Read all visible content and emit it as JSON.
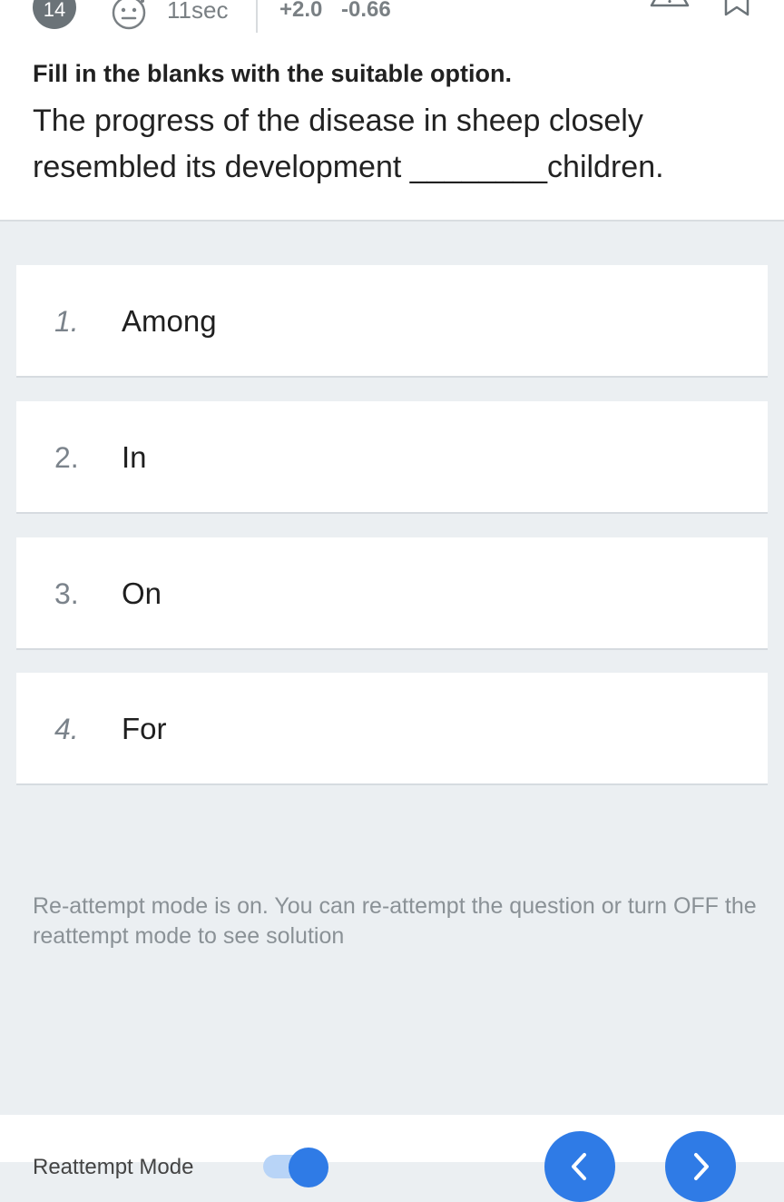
{
  "header": {
    "question_number": "14",
    "timer": "11sec",
    "marks_positive": "+2.0",
    "marks_negative": "-0.66",
    "icons": [
      "neutral-face-icon",
      "warning-icon",
      "bookmark-icon"
    ]
  },
  "question": {
    "instruction": "Fill in the blanks with the suitable option.",
    "text": "The progress of the disease in sheep closely resembled its development ________children."
  },
  "options": [
    {
      "number": "1.",
      "label": "Among"
    },
    {
      "number": "2.",
      "label": "In"
    },
    {
      "number": "3.",
      "label": "On"
    },
    {
      "number": "4.",
      "label": "For"
    }
  ],
  "reattempt_notice": "Re-attempt mode is on. You can re-attempt the question or turn OFF the reattempt mode to see solution",
  "bottom_bar": {
    "mode_label": "Reattempt Mode",
    "mode_on": true,
    "icons": [
      "chevron-left-icon",
      "chevron-right-icon"
    ]
  },
  "colors": {
    "accent": "#2f7be6",
    "background": "#ebeff2",
    "muted_text": "#8a9196"
  }
}
